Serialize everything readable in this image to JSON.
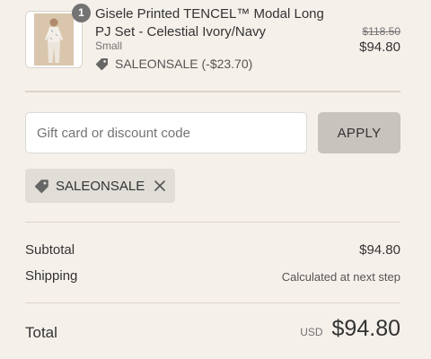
{
  "colors": {
    "page_background": "#f5f0ea",
    "text_primary": "#333333",
    "text_secondary": "#737373",
    "badge": "#737373",
    "apply_button": "#c8c3bd",
    "applied_tag_background": "#e1ddd7",
    "divider": "#dcd4cc"
  },
  "line_item": {
    "quantity": "1",
    "title": "Gisele Printed TENCEL™ Modal Long PJ Set - Celestial Ivory/Navy",
    "variant": "Small",
    "discount_icon": "tag-icon",
    "discount": "SALEONSALE (-$23.70)",
    "compare_price": "$118.50",
    "price": "$94.80"
  },
  "discount_form": {
    "placeholder": "Gift card or discount code",
    "value": "",
    "apply_label": "APPLY"
  },
  "applied_code": {
    "icon": "tag-icon",
    "code": "SALEONSALE",
    "remove_icon": "close-icon"
  },
  "summary": {
    "subtotal_label": "Subtotal",
    "subtotal_value": "$94.80",
    "shipping_label": "Shipping",
    "shipping_value": "Calculated at next step"
  },
  "total": {
    "label": "Total",
    "currency": "USD",
    "value": "$94.80"
  }
}
